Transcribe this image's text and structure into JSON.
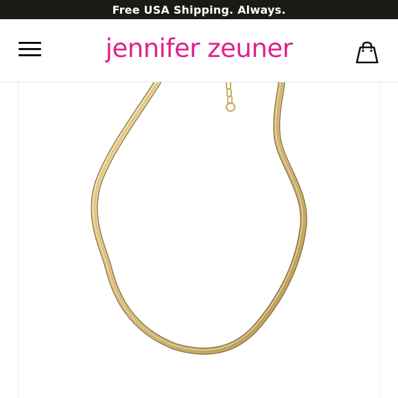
{
  "promo": {
    "text": "Free USA Shipping. Always."
  },
  "header": {
    "brand": "jennifer zeuner",
    "menu_icon": "hamburger-menu-icon",
    "cart_icon": "shopping-bag-icon"
  },
  "product": {
    "image": "gold-herringbone-chain-necklace"
  },
  "colors": {
    "promo_background": "#1b1a17",
    "brand_pink": "#e0218a",
    "gold": "#d8be7e"
  }
}
